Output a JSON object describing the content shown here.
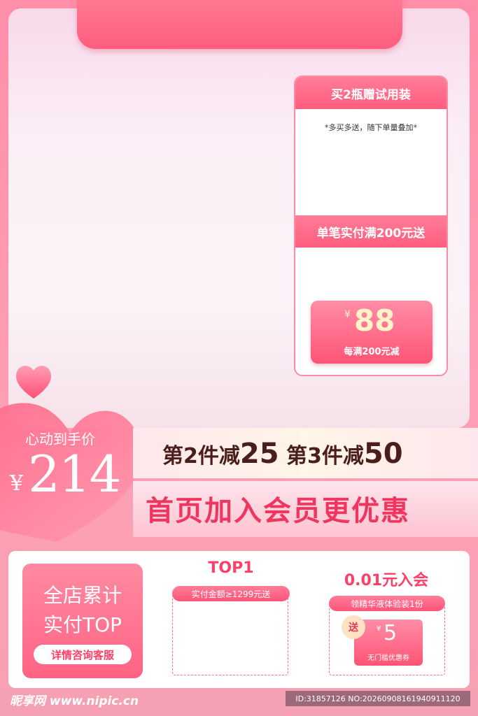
{
  "promo": {
    "header1": "买2瓶赠试用装",
    "note": "*多买多送，随下单量叠加*",
    "header2": "单笔实付满200元送",
    "coupon_currency": "¥",
    "coupon_amount": "88",
    "coupon_desc": "每满200元减"
  },
  "price": {
    "label": "心动到手价",
    "currency": "¥",
    "value": "214"
  },
  "discount": {
    "part1": "第2件减",
    "val1": "25",
    "part2": "第3件减",
    "val2": "50"
  },
  "member_banner": "首页加入会员更优惠",
  "ranking": {
    "line1": "全店累计",
    "line2": "实付TOP",
    "button": "详情咨询客服"
  },
  "top1": {
    "title": "TOP1",
    "tag": "实付金额≥1299元送"
  },
  "join": {
    "title": "0.01元入会",
    "tag": "领精华液体验装1份",
    "send": "送",
    "coupon_currency": "¥",
    "coupon_amount": "5",
    "coupon_desc": "无门槛优惠券"
  },
  "watermark": {
    "logo": "昵享网 www.nipic.cn",
    "id": "ID:31857126 NO:20260908161940911120"
  },
  "colors": {
    "accent": "#ff5d7f",
    "title_red": "#f0365f",
    "band_text": "#4a1e1a"
  }
}
